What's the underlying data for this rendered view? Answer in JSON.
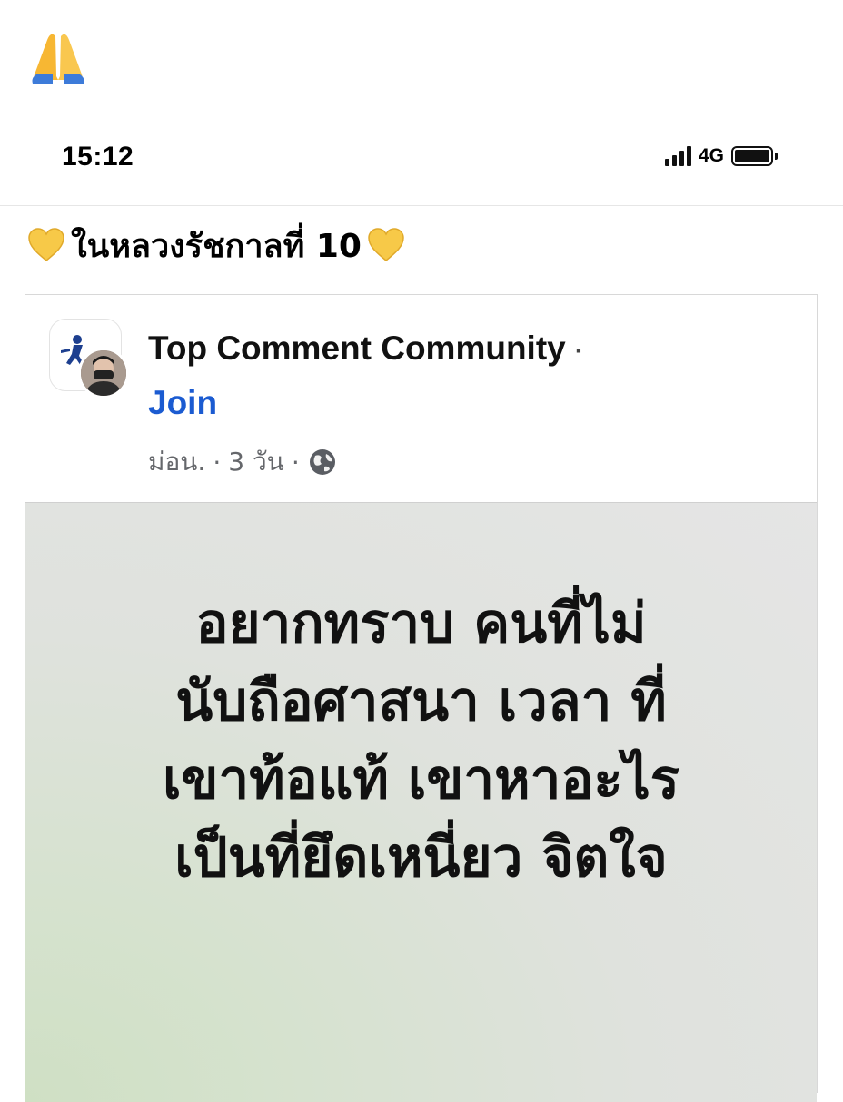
{
  "top_emoji": "folded-hands-emoji",
  "status_bar": {
    "time": "15:12",
    "network": "4G",
    "signal_icon": "signal-bars-icon",
    "battery_icon": "battery-icon"
  },
  "caption": {
    "text": "ในหลวงรัชกาลที่ 10",
    "emoji": "yellow-heart-emoji",
    "emoji_color": "#f7c948"
  },
  "post": {
    "group_name": "Top Comment Community",
    "separator": "·",
    "join_label": "Join",
    "author": "ม่อน.",
    "time_ago": "3 วัน",
    "privacy_icon": "globe-icon",
    "join_color": "#1b5bd1",
    "image_text_lines": [
      "อยากทราบ คนที่ไม่",
      "นับถือศาสนา เวลา ที่",
      "เขาท้อแท้ เขาหาอะไร",
      "เป็นที่ยึดเหนี่ยว จิตใจ"
    ]
  }
}
